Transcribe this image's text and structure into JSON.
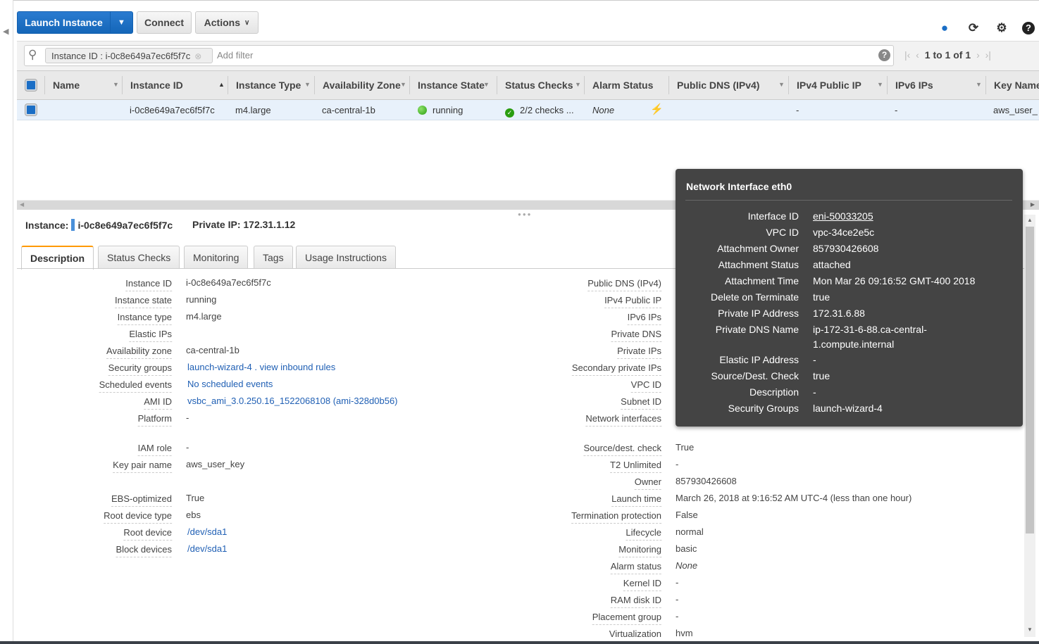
{
  "toolbar": {
    "launch": "Launch Instance",
    "connect": "Connect",
    "actions": "Actions",
    "icons": [
      "chat-icon",
      "refresh-icon",
      "gear-icon",
      "help-icon"
    ]
  },
  "filter": {
    "chip_label": "Instance ID : i-0c8e649a7ec6f5f7c",
    "placeholder": "Add filter",
    "pager": "1 to 1 of 1"
  },
  "table": {
    "columns": [
      "Name",
      "Instance ID",
      "Instance Type",
      "Availability Zone",
      "Instance State",
      "Status Checks",
      "Alarm Status",
      "Public DNS (IPv4)",
      "IPv4 Public IP",
      "IPv6 IPs",
      "Key Name"
    ],
    "row": {
      "name": "",
      "instance_id": "i-0c8e649a7ec6f5f7c",
      "type": "m4.large",
      "az": "ca-central-1b",
      "state": "running",
      "status_checks": "2/2 checks ...",
      "alarm": "None",
      "public_dns": "",
      "ipv4": "-",
      "ipv6": "-",
      "key_name": "aws_user_"
    }
  },
  "details": {
    "instance_label": "Instance:",
    "instance_id": "i-0c8e649a7ec6f5f7c",
    "private_ip": "Private IP: 172.31.1.12",
    "tabs": [
      "Description",
      "Status Checks",
      "Monitoring",
      "Tags",
      "Usage Instructions"
    ],
    "left": [
      {
        "label": "Instance ID",
        "value": "i-0c8e649a7ec6f5f7c"
      },
      {
        "label": "Instance state",
        "value": "running"
      },
      {
        "label": "Instance type",
        "value": "m4.large"
      },
      {
        "label": "Elastic IPs",
        "value": ""
      },
      {
        "label": "Availability zone",
        "value": "ca-central-1b"
      },
      {
        "label": "Security groups",
        "value": "launch-wizard-4 .  view inbound rules",
        "link": true
      },
      {
        "label": "Scheduled events",
        "value": "No scheduled events",
        "link": true
      },
      {
        "label": "AMI ID",
        "value": "vsbc_ami_3.0.250.16_1522068108 (ami-328d0b56)",
        "link": true
      },
      {
        "label": "Platform",
        "value": "-"
      },
      {
        "label": "IAM role",
        "value": "-"
      },
      {
        "label": "Key pair name",
        "value": "aws_user_key"
      },
      {
        "label": "EBS-optimized",
        "value": "True"
      },
      {
        "label": "Root device type",
        "value": "ebs"
      },
      {
        "label": "Root device",
        "value": "/dev/sda1",
        "link": true
      },
      {
        "label": "Block devices",
        "value": "/dev/sda1",
        "link": true
      }
    ],
    "right": [
      {
        "label": "Public DNS (IPv4)",
        "value": ""
      },
      {
        "label": "IPv4 Public IP",
        "value": ""
      },
      {
        "label": "IPv6 IPs",
        "value": ""
      },
      {
        "label": "Private DNS",
        "value": ""
      },
      {
        "label": "Private IPs",
        "value": ""
      },
      {
        "label": "Secondary private IPs",
        "value": ""
      },
      {
        "label": "VPC ID",
        "value": ""
      },
      {
        "label": "Subnet ID",
        "value": ""
      },
      {
        "label": "Network interfaces",
        "value": ""
      },
      {
        "label": "Source/dest. check",
        "value": "True"
      },
      {
        "label": "T2 Unlimited",
        "value": "-"
      },
      {
        "label": "Owner",
        "value": "857930426608"
      },
      {
        "label": "Launch time",
        "value": "March 26, 2018 at 9:16:52 AM UTC-4 (less than one hour)"
      },
      {
        "label": "Termination protection",
        "value": "False"
      },
      {
        "label": "Lifecycle",
        "value": "normal"
      },
      {
        "label": "Monitoring",
        "value": "basic"
      },
      {
        "label": "Alarm status",
        "value": "None",
        "italic": true
      },
      {
        "label": "Kernel ID",
        "value": "-"
      },
      {
        "label": "RAM disk ID",
        "value": "-"
      },
      {
        "label": "Placement group",
        "value": "-"
      },
      {
        "label": "Virtualization",
        "value": "hvm"
      }
    ]
  },
  "popup": {
    "title": "Network Interface eth0",
    "rows": [
      {
        "label": "Interface ID",
        "value": "eni-50033205",
        "link": true
      },
      {
        "label": "VPC ID",
        "value": "vpc-34ce2e5c"
      },
      {
        "label": "Attachment Owner",
        "value": "857930426608"
      },
      {
        "label": "Attachment Status",
        "value": "attached"
      },
      {
        "label": "Attachment Time",
        "value": "Mon Mar 26 09:16:52 GMT-400 2018"
      },
      {
        "label": "Delete on Terminate",
        "value": "true"
      },
      {
        "label": "Private IP Address",
        "value": "172.31.6.88"
      },
      {
        "label": "Private DNS Name",
        "value": "ip-172-31-6-88.ca-central-\n1.compute.internal"
      },
      {
        "label": "Elastic IP Address",
        "value": "-"
      },
      {
        "label": "Source/Dest. Check",
        "value": "true"
      },
      {
        "label": "Description",
        "value": "-"
      },
      {
        "label": "Security Groups",
        "value": "launch-wizard-4"
      }
    ]
  },
  "colors": {
    "primary": "#1a6ec6",
    "active_tab": "#ff9900",
    "row_selected": "#e8f1fb",
    "popup_bg": "#444444"
  }
}
